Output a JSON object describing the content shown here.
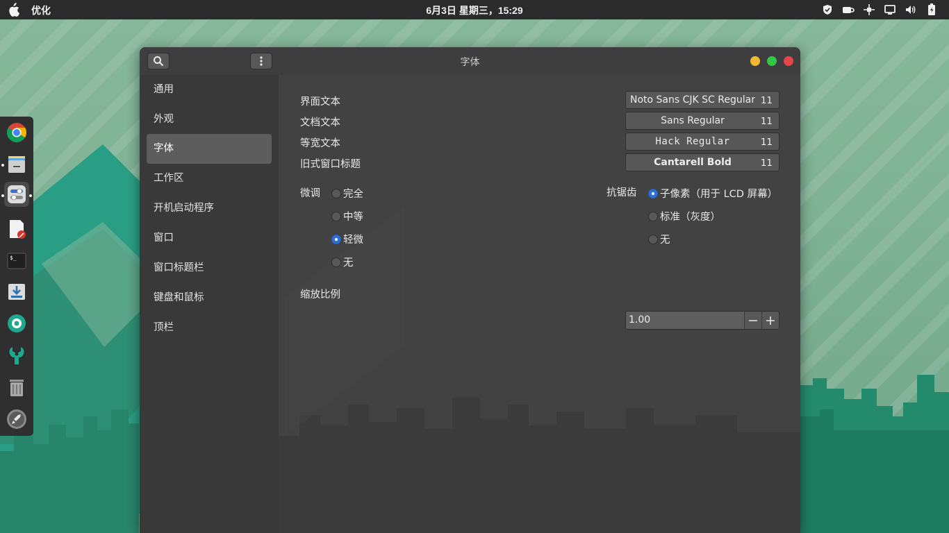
{
  "topbar": {
    "app_name": "优化",
    "clock": "6月3日 星期三，15:29",
    "tray_icons": [
      "shield-icon",
      "cup-icon",
      "network-icon",
      "display-icon",
      "volume-icon",
      "battery-icon"
    ]
  },
  "dock": {
    "apps": [
      "chrome",
      "files",
      "tweaks",
      "text-editor",
      "terminal",
      "download-manager",
      "camera-app",
      "settings-tools",
      "trash",
      "launcher"
    ]
  },
  "window": {
    "title": "字体",
    "sidebar": {
      "items": [
        "通用",
        "外观",
        "字体",
        "工作区",
        "开机启动程序",
        "窗口",
        "窗口标题栏",
        "键盘和鼠标",
        "顶栏"
      ],
      "selected": "字体"
    },
    "fonts": {
      "rows": [
        {
          "label": "界面文本",
          "font": "Noto Sans CJK SC Regular",
          "size": "11"
        },
        {
          "label": "文档文本",
          "font": "Sans Regular",
          "size": "11"
        },
        {
          "label": "等宽文本",
          "font": "Hack Regular",
          "size": "11"
        },
        {
          "label": "旧式窗口标题",
          "font": "Cantarell Bold",
          "size": "11"
        }
      ]
    },
    "hinting": {
      "label": "微调",
      "options": [
        "完全",
        "中等",
        "轻微",
        "无"
      ],
      "selected": "轻微"
    },
    "antialiasing": {
      "label": "抗锯齿",
      "options": [
        "子像素（用于 LCD 屏幕）",
        "标准（灰度）",
        "无"
      ],
      "selected": "子像素（用于 LCD 屏幕）"
    },
    "scaling": {
      "label": "缩放比例",
      "value": "1.00",
      "minus": "−",
      "plus": "+"
    }
  },
  "colors": {
    "accent": "#2f6fd8",
    "window_bg": "#3e3e3e",
    "close": "#e6454a",
    "minimize": "#f1b92e",
    "maximize": "#33c748"
  }
}
